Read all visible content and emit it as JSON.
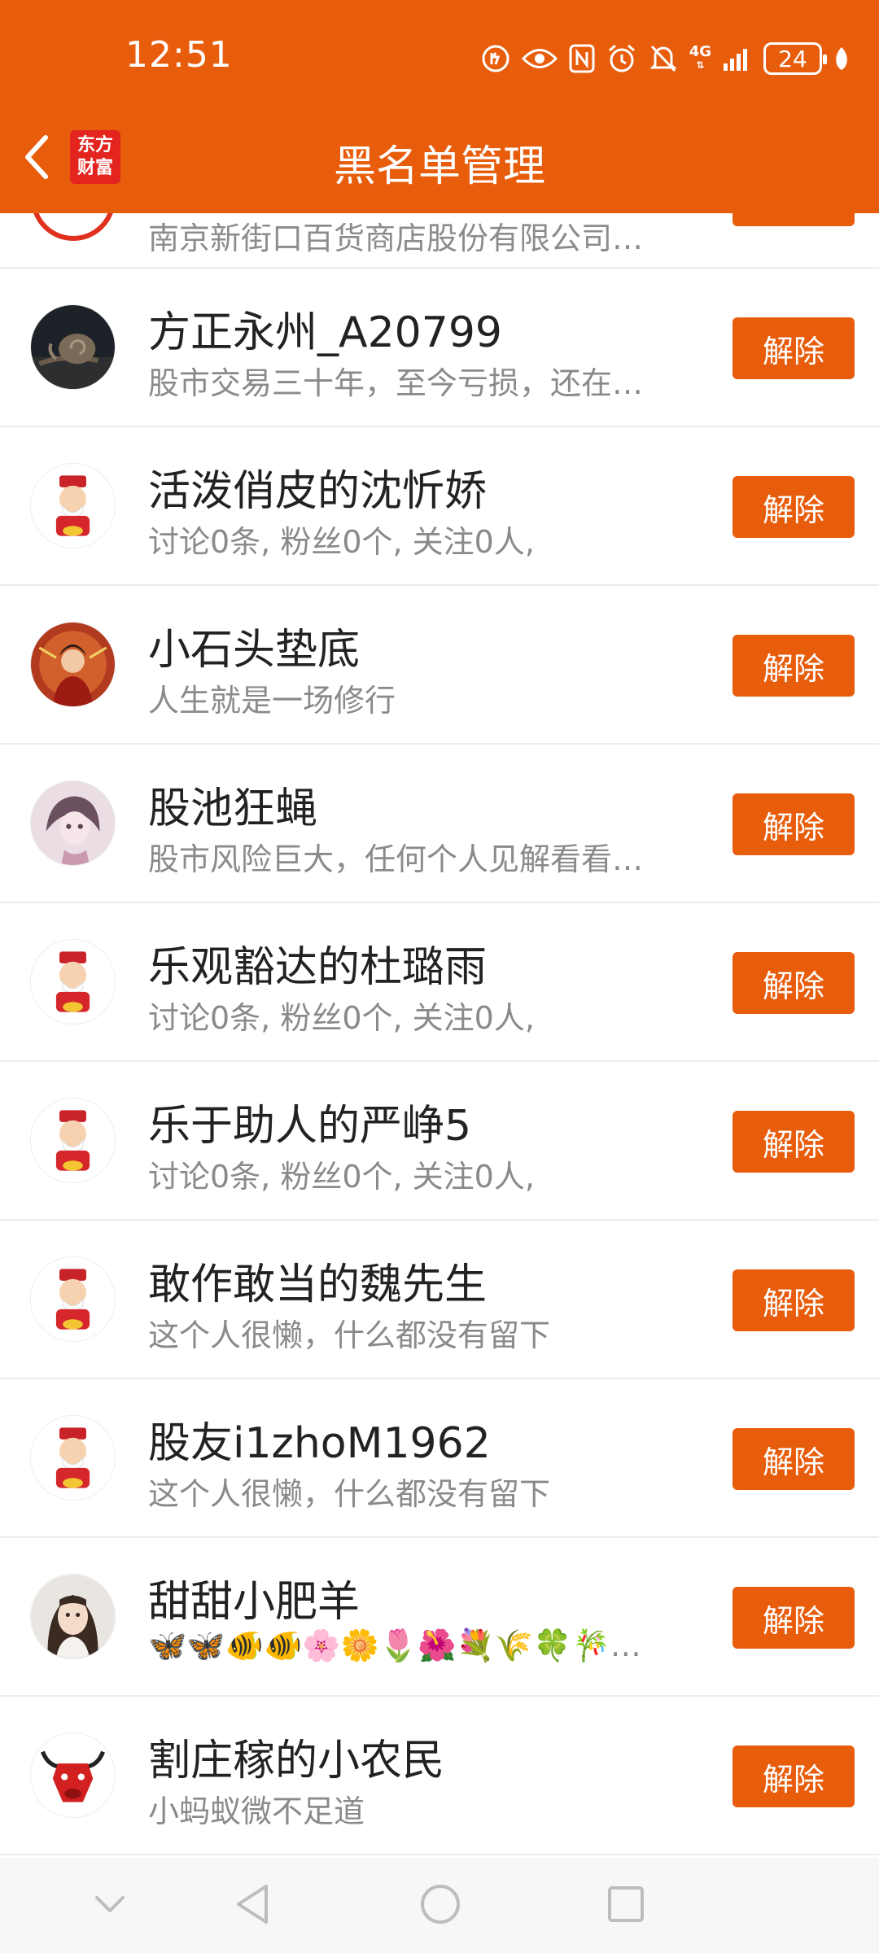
{
  "status_bar": {
    "time": "12:51",
    "network": "4G",
    "battery": "24"
  },
  "header": {
    "brand_logo_text": [
      "东方",
      "财富"
    ],
    "title": "黑名单管理"
  },
  "partial_row": {
    "description": "南京新街口百货商店股份有限公司…"
  },
  "rows": [
    {
      "name": "方正永州_A20799",
      "description": "股市交易三十年，至今亏损，还在…",
      "avatar": "snail-photo",
      "button": "解除"
    },
    {
      "name": "活泼俏皮的沈忻娇",
      "description": "讨论0条, 粉丝0个, 关注0人,",
      "avatar": "fortune-god-avatar",
      "button": "解除"
    },
    {
      "name": "小石头垫底",
      "description": "人生就是一场修行",
      "avatar": "woman-red-costume-photo",
      "button": "解除"
    },
    {
      "name": "股池狂蝇",
      "description": "股市风险巨大，任何个人见解看看…",
      "avatar": "anime-girl-avatar",
      "button": "解除"
    },
    {
      "name": "乐观豁达的杜璐雨",
      "description": "讨论0条, 粉丝0个, 关注0人,",
      "avatar": "fortune-god-avatar",
      "button": "解除"
    },
    {
      "name": "乐于助人的严峥5",
      "description": "讨论0条, 粉丝0个, 关注0人,",
      "avatar": "fortune-god-avatar",
      "button": "解除"
    },
    {
      "name": "敢作敢当的魏先生",
      "description": "这个人很懒，什么都没有留下",
      "avatar": "fortune-god-avatar",
      "button": "解除"
    },
    {
      "name": "股友i1zhoM1962",
      "description": "这个人很懒，什么都没有留下",
      "avatar": "fortune-god-avatar",
      "button": "解除"
    },
    {
      "name": "甜甜小肥羊",
      "description": "🦋🦋🐠🐠🌸🌼🌷🌺💐🌾🍀🎋…",
      "avatar": "girl-photo",
      "button": "解除"
    },
    {
      "name": "割庄稼的小农民",
      "description": "小蚂蚁微不足道",
      "avatar": "bull-avatar",
      "button": "解除"
    }
  ],
  "colors": {
    "brand_orange": "#e85d0c",
    "logo_red": "#e4241f",
    "name_text": "#222222",
    "desc_text": "#8a8a8a"
  }
}
